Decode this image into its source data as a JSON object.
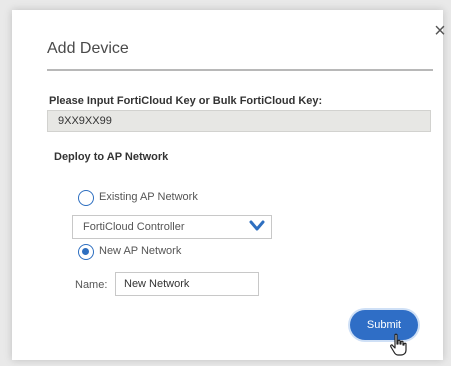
{
  "dialog": {
    "title": "Add Device",
    "close_glyph": "×",
    "close_icon": "close-icon"
  },
  "key": {
    "label": "Please Input FortiCloud Key or Bulk FortiCloud Key:",
    "value": "9XX9XX99"
  },
  "deploy": {
    "label": "Deploy to AP Network",
    "existing_label": "Existing AP Network",
    "existing_checked": false,
    "controller_value": "FortiCloud Controller",
    "new_label": "New AP Network",
    "new_checked": true,
    "name_label": "Name:",
    "name_value": "New Network"
  },
  "actions": {
    "submit_label": "Submit"
  },
  "colors": {
    "accent": "#2f6ec6"
  },
  "icons": {
    "dropdown": "chevron-down-icon",
    "pointer": "hand-pointer-icon"
  }
}
